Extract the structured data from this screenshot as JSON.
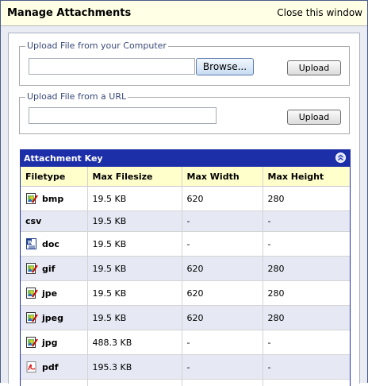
{
  "window": {
    "title": "Manage Attachments",
    "close_label": "Close this window"
  },
  "upload_computer": {
    "legend": "Upload File from your Computer",
    "file_value": "",
    "browse_label": "Browse...",
    "upload_label": "Upload"
  },
  "upload_url": {
    "legend": "Upload File from a URL",
    "url_value": "",
    "upload_label": "Upload"
  },
  "attachment_key": {
    "title": "Attachment Key",
    "columns": [
      "Filetype",
      "Max Filesize",
      "Max Width",
      "Max Height"
    ],
    "rows": [
      {
        "type": "bmp",
        "icon": "image-icon",
        "size": "19.5 KB",
        "width": "620",
        "height": "280"
      },
      {
        "type": "csv",
        "icon": "none",
        "size": "19.5 KB",
        "width": "-",
        "height": "-"
      },
      {
        "type": "doc",
        "icon": "word-icon",
        "size": "19.5 KB",
        "width": "-",
        "height": "-"
      },
      {
        "type": "gif",
        "icon": "image-icon",
        "size": "19.5 KB",
        "width": "620",
        "height": "280"
      },
      {
        "type": "jpe",
        "icon": "image-icon",
        "size": "19.5 KB",
        "width": "620",
        "height": "280"
      },
      {
        "type": "jpeg",
        "icon": "image-icon",
        "size": "19.5 KB",
        "width": "620",
        "height": "280"
      },
      {
        "type": "jpg",
        "icon": "image-icon",
        "size": "488.3 KB",
        "width": "-",
        "height": "-"
      },
      {
        "type": "pdf",
        "icon": "pdf-icon",
        "size": "195.3 KB",
        "width": "-",
        "height": "-"
      },
      {
        "type": "",
        "icon": "file-icon",
        "size": "",
        "width": "",
        "height": ""
      }
    ]
  },
  "colors": {
    "title_bg": "#ffffe6",
    "key_header_bg": "#1c2ea8",
    "column_header_bg": "#ffffcc",
    "alt_row_bg": "#e6e9f4"
  }
}
